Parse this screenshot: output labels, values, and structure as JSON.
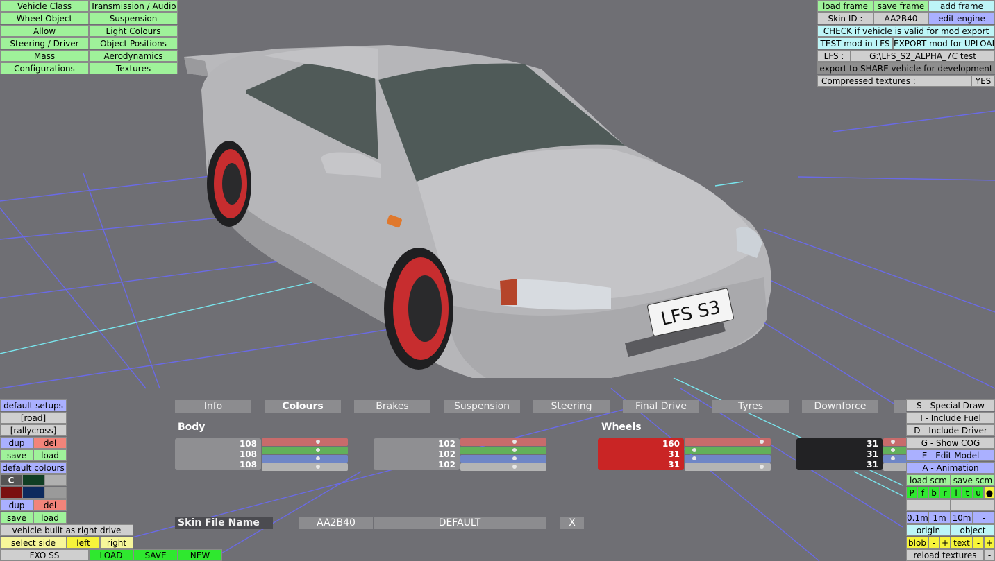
{
  "top_left_menu": [
    [
      "Vehicle Class",
      "Transmission / Audio"
    ],
    [
      "Wheel Object",
      "Suspension"
    ],
    [
      "Allow",
      "Light Colours"
    ],
    [
      "Steering / Driver",
      "Object Positions"
    ],
    [
      "Mass",
      "Aerodynamics"
    ],
    [
      "Configurations",
      "Textures"
    ]
  ],
  "top_right": {
    "load_frame": "load frame",
    "save_frame": "save frame",
    "add_frame": "add frame",
    "skin_id_label": "Skin ID :",
    "skin_id_value": "AA2B40",
    "edit_engine": "edit engine",
    "check_valid": "CHECK if vehicle is valid for mod export",
    "test_mod": "TEST mod in LFS",
    "export_upload": "EXPORT mod for UPLOAD",
    "lfs_label": "LFS :",
    "lfs_path": "G:\\LFS_S2_ALPHA_7C test",
    "export_share": "export to SHARE vehicle for development",
    "compressed_label": "Compressed textures :",
    "compressed_value": "YES"
  },
  "plate_text": "LFS S3",
  "tabs": [
    "Info",
    "Colours",
    "Brakes",
    "Suspension",
    "Steering",
    "Final Drive",
    "Tyres",
    "Downforce"
  ],
  "active_tab": "Colours",
  "colours": {
    "body_title": "Body",
    "wheels_title": "Wheels",
    "blocks": [
      {
        "values": [
          "108",
          "108",
          "108"
        ],
        "swatch": "#8f8f92",
        "sliders": [
          0.68,
          0.68,
          0.68,
          0.68
        ]
      },
      {
        "values": [
          "102",
          "102",
          "102"
        ],
        "swatch": "#8f8f92",
        "sliders": [
          0.66,
          0.66,
          0.66,
          0.66
        ]
      },
      {
        "values": [
          "160",
          "31",
          "31"
        ],
        "swatch": "#c92525",
        "sliders": [
          0.95,
          0.1,
          0.1,
          0.95
        ]
      },
      {
        "values": [
          "31",
          "31",
          "31"
        ],
        "swatch": "#222224",
        "sliders": [
          0.1,
          0.1,
          0.1,
          0.95
        ]
      }
    ],
    "slider_colors": [
      "#c86b6b",
      "#62b05a",
      "#6f86c6",
      "#b4b4b4"
    ]
  },
  "skin_row": {
    "label": "Skin File Name",
    "id": "AA2B40",
    "name": "DEFAULT",
    "close": "X"
  },
  "left_panel": {
    "default_setups": "default setups",
    "road": "[road]",
    "rallycross": "[rallycross]",
    "dup": "dup",
    "del": "del",
    "save": "save",
    "load": "load",
    "default_colours": "default colours",
    "c_label": "C",
    "swatch_colors": [
      "#103e24",
      "#b0b0b0",
      "#7a1010",
      "#0d2a5e",
      "#9a9a9a"
    ],
    "right_drive": "vehicle built as right drive",
    "select_side": "select side",
    "left": "left",
    "right": "right",
    "fxo": "FXO SS",
    "load_btn": "LOAD",
    "save_btn": "SAVE",
    "new_btn": "NEW"
  },
  "right_panel": {
    "special_draw": "S - Special Draw",
    "include_fuel": "I - Include Fuel",
    "include_driver": "D - Include Driver",
    "show_cog": "G - Show COG",
    "edit_model": "E - Edit Model",
    "animation": "A - Animation",
    "load_scm": "load scm",
    "save_scm": "save scm",
    "letters": [
      "P",
      "f",
      "b",
      "r",
      "l",
      "t",
      "u"
    ],
    "dot": "●",
    "dash": "-",
    "scales": [
      "0.1m",
      "1m",
      "10m"
    ],
    "minus": "-",
    "plus": "+",
    "origin": "origin",
    "object": "object",
    "blob": "blob",
    "text": "text",
    "reload": "reload textures"
  }
}
